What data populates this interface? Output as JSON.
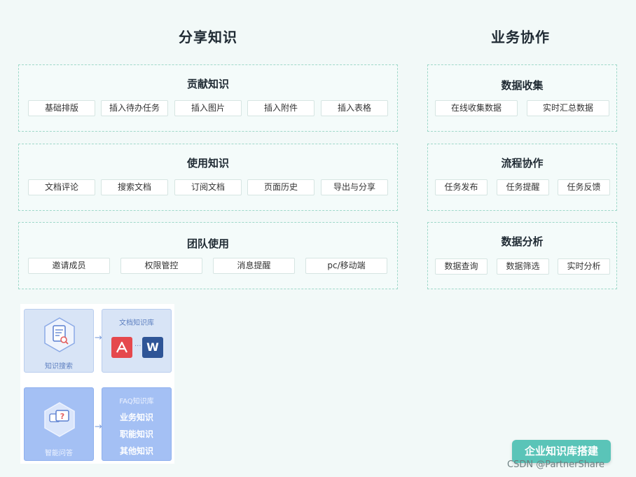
{
  "left_title": "分享知识",
  "right_title": "业务协作",
  "share_groups": [
    {
      "title": "贡献知识",
      "items": [
        "基础排版",
        "插入待办任务",
        "插入图片",
        "插入附件",
        "插入表格"
      ]
    },
    {
      "title": "使用知识",
      "items": [
        "文档评论",
        "搜索文档",
        "订阅文档",
        "页面历史",
        "导出与分享"
      ]
    },
    {
      "title": "团队使用",
      "items": [
        "邀请成员",
        "权限管控",
        "消息提醒",
        "pc/移动端"
      ]
    }
  ],
  "collab_groups": [
    {
      "title": "数据收集",
      "items": [
        "在线收集数据",
        "实时汇总数据"
      ]
    },
    {
      "title": "流程协作",
      "items": [
        "任务发布",
        "任务提醒",
        "任务反馈"
      ]
    },
    {
      "title": "数据分析",
      "items": [
        "数据查询",
        "数据筛选",
        "实时分析"
      ]
    }
  ],
  "illustration": {
    "search_label": "知识搜索",
    "doc_lib_label": "文档知识库",
    "pdf_icon_name": "pdf-icon",
    "word_letter": "W",
    "qa_label": "智能问答",
    "faq_lib_label": "FAQ知识库",
    "faq_items": [
      "业务知识",
      "职能知识",
      "其他知识"
    ]
  },
  "cta_button": "企业知识库搭建",
  "watermark": "CSDN @PartnerShare",
  "colors": {
    "accent": "#5ac4b8",
    "dashed_border": "#9fd8c9",
    "illus_blue": "#a4c0f4"
  }
}
